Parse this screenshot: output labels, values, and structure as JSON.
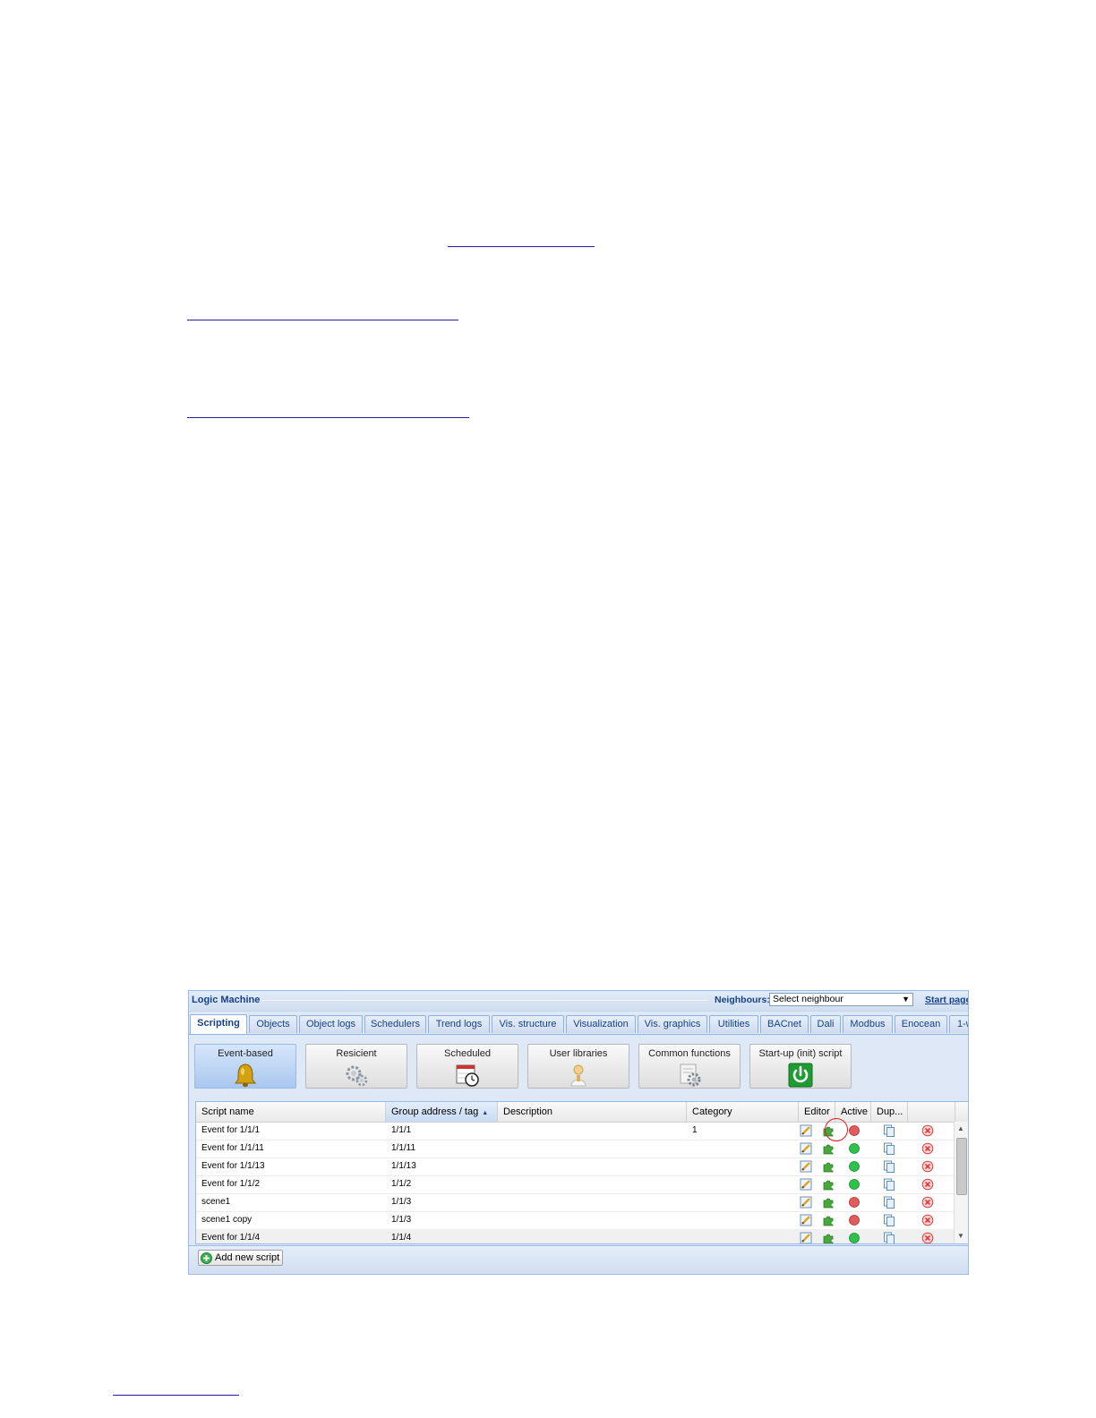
{
  "app": {
    "title": "Logic Machine",
    "neighbours_label": "Neighbours:",
    "neighbours_select_value": "Select neighbour",
    "start_page_link": "Start page"
  },
  "tabs": [
    {
      "label": "Scripting",
      "active": true
    },
    {
      "label": "Objects"
    },
    {
      "label": "Object logs"
    },
    {
      "label": "Schedulers"
    },
    {
      "label": "Trend logs"
    },
    {
      "label": "Vis. structure"
    },
    {
      "label": "Visualization"
    },
    {
      "label": "Vis. graphics"
    },
    {
      "label": "Utilities"
    },
    {
      "label": "BACnet"
    },
    {
      "label": "Dali"
    },
    {
      "label": "Modbus"
    },
    {
      "label": "Enocean"
    },
    {
      "label": "1-w"
    }
  ],
  "subtabs": [
    {
      "label": "Event-based",
      "icon": "bell-icon",
      "active": true
    },
    {
      "label": "Resicient",
      "icon": "gears-icon"
    },
    {
      "label": "Scheduled",
      "icon": "calendar-clock-icon"
    },
    {
      "label": "User libraries",
      "icon": "user-icon"
    },
    {
      "label": "Common functions",
      "icon": "document-gear-icon"
    },
    {
      "label": "Start-up (init) script",
      "icon": "power-icon"
    }
  ],
  "grid": {
    "columns": {
      "script_name": "Script name",
      "group_address": "Group address / tag",
      "description": "Description",
      "category": "Category",
      "editor": "Editor",
      "active": "Active",
      "duplicate": "Dup..."
    },
    "rows": [
      {
        "name": "Event for 1/1/1",
        "address": "1/1/1",
        "description": "",
        "category": "1",
        "active": false
      },
      {
        "name": "Event for 1/1/11",
        "address": "1/1/11",
        "description": "",
        "category": "",
        "active": true
      },
      {
        "name": "Event for 1/1/13",
        "address": "1/1/13",
        "description": "",
        "category": "",
        "active": true
      },
      {
        "name": "Event for 1/1/2",
        "address": "1/1/2",
        "description": "",
        "category": "",
        "active": true
      },
      {
        "name": "scene1",
        "address": "1/1/3",
        "description": "",
        "category": "",
        "active": false
      },
      {
        "name": "scene1 copy",
        "address": "1/1/3",
        "description": "",
        "category": "",
        "active": false
      },
      {
        "name": "Event for 1/1/4",
        "address": "1/1/4",
        "description": "",
        "category": "",
        "active": true
      }
    ]
  },
  "footer": {
    "add_button": "Add new script"
  },
  "colors": {
    "active_green": "#2fc24a",
    "inactive_red": "#e35c5c",
    "delete_red": "#e23a3a",
    "highlight_red": "#d81f1f",
    "header_blue": "#15428b"
  }
}
